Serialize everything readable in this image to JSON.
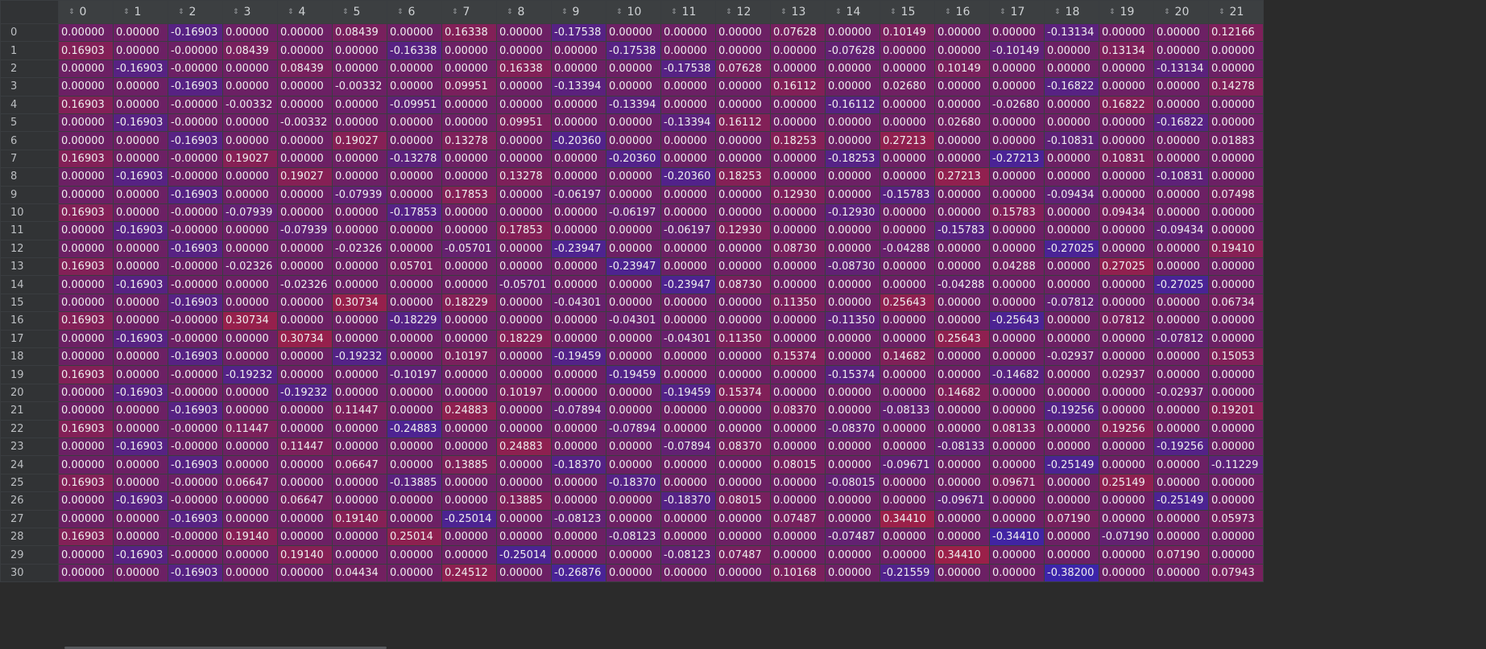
{
  "columns": [
    "0",
    "1",
    "2",
    "3",
    "4",
    "5",
    "6",
    "7",
    "8",
    "9",
    "10",
    "11",
    "12",
    "13",
    "14",
    "15",
    "16",
    "17",
    "18",
    "19",
    "20",
    "21"
  ],
  "sort_icon": "sort-updown-icon",
  "rows": [
    {
      "index": "0",
      "cells": [
        "0.00000",
        "0.00000",
        "-0.16903",
        "0.00000",
        "0.00000",
        "0.08439",
        "0.00000",
        "0.16338",
        "0.00000",
        "-0.17538",
        "0.00000",
        "0.00000",
        "0.00000",
        "0.07628",
        "0.00000",
        "0.10149",
        "0.00000",
        "0.00000",
        "-0.13134",
        "0.00000",
        "0.00000",
        "0.12166"
      ]
    },
    {
      "index": "1",
      "cells": [
        "0.16903",
        "0.00000",
        "-0.00000",
        "0.08439",
        "0.00000",
        "0.00000",
        "-0.16338",
        "0.00000",
        "0.00000",
        "0.00000",
        "-0.17538",
        "0.00000",
        "0.00000",
        "0.00000",
        "-0.07628",
        "0.00000",
        "0.00000",
        "-0.10149",
        "0.00000",
        "0.13134",
        "0.00000",
        "0.00000"
      ]
    },
    {
      "index": "2",
      "cells": [
        "0.00000",
        "-0.16903",
        "-0.00000",
        "0.00000",
        "0.08439",
        "0.00000",
        "0.00000",
        "0.00000",
        "0.16338",
        "0.00000",
        "0.00000",
        "-0.17538",
        "0.07628",
        "0.00000",
        "0.00000",
        "0.00000",
        "0.10149",
        "0.00000",
        "0.00000",
        "0.00000",
        "-0.13134",
        "0.00000"
      ]
    },
    {
      "index": "3",
      "cells": [
        "0.00000",
        "0.00000",
        "-0.16903",
        "0.00000",
        "0.00000",
        "-0.00332",
        "0.00000",
        "0.09951",
        "0.00000",
        "-0.13394",
        "0.00000",
        "0.00000",
        "0.00000",
        "0.16112",
        "0.00000",
        "0.02680",
        "0.00000",
        "0.00000",
        "-0.16822",
        "0.00000",
        "0.00000",
        "0.14278"
      ]
    },
    {
      "index": "4",
      "cells": [
        "0.16903",
        "0.00000",
        "-0.00000",
        "-0.00332",
        "0.00000",
        "0.00000",
        "-0.09951",
        "0.00000",
        "0.00000",
        "0.00000",
        "-0.13394",
        "0.00000",
        "0.00000",
        "0.00000",
        "-0.16112",
        "0.00000",
        "0.00000",
        "-0.02680",
        "0.00000",
        "0.16822",
        "0.00000",
        "0.00000"
      ]
    },
    {
      "index": "5",
      "cells": [
        "0.00000",
        "-0.16903",
        "-0.00000",
        "0.00000",
        "-0.00332",
        "0.00000",
        "0.00000",
        "0.00000",
        "0.09951",
        "0.00000",
        "0.00000",
        "-0.13394",
        "0.16112",
        "0.00000",
        "0.00000",
        "0.00000",
        "0.02680",
        "0.00000",
        "0.00000",
        "0.00000",
        "-0.16822",
        "0.00000"
      ]
    },
    {
      "index": "6",
      "cells": [
        "0.00000",
        "0.00000",
        "-0.16903",
        "0.00000",
        "0.00000",
        "0.19027",
        "0.00000",
        "0.13278",
        "0.00000",
        "-0.20360",
        "0.00000",
        "0.00000",
        "0.00000",
        "0.18253",
        "0.00000",
        "0.27213",
        "0.00000",
        "0.00000",
        "-0.10831",
        "0.00000",
        "0.00000",
        "0.01883"
      ]
    },
    {
      "index": "7",
      "cells": [
        "0.16903",
        "0.00000",
        "-0.00000",
        "0.19027",
        "0.00000",
        "0.00000",
        "-0.13278",
        "0.00000",
        "0.00000",
        "0.00000",
        "-0.20360",
        "0.00000",
        "0.00000",
        "0.00000",
        "-0.18253",
        "0.00000",
        "0.00000",
        "-0.27213",
        "0.00000",
        "0.10831",
        "0.00000",
        "0.00000"
      ]
    },
    {
      "index": "8",
      "cells": [
        "0.00000",
        "-0.16903",
        "-0.00000",
        "0.00000",
        "0.19027",
        "0.00000",
        "0.00000",
        "0.00000",
        "0.13278",
        "0.00000",
        "0.00000",
        "-0.20360",
        "0.18253",
        "0.00000",
        "0.00000",
        "0.00000",
        "0.27213",
        "0.00000",
        "0.00000",
        "0.00000",
        "-0.10831",
        "0.00000"
      ]
    },
    {
      "index": "9",
      "cells": [
        "0.00000",
        "0.00000",
        "-0.16903",
        "0.00000",
        "0.00000",
        "-0.07939",
        "0.00000",
        "0.17853",
        "0.00000",
        "-0.06197",
        "0.00000",
        "0.00000",
        "0.00000",
        "0.12930",
        "0.00000",
        "-0.15783",
        "0.00000",
        "0.00000",
        "-0.09434",
        "0.00000",
        "0.00000",
        "0.07498"
      ]
    },
    {
      "index": "10",
      "cells": [
        "0.16903",
        "0.00000",
        "-0.00000",
        "-0.07939",
        "0.00000",
        "0.00000",
        "-0.17853",
        "0.00000",
        "0.00000",
        "0.00000",
        "-0.06197",
        "0.00000",
        "0.00000",
        "0.00000",
        "-0.12930",
        "0.00000",
        "0.00000",
        "0.15783",
        "0.00000",
        "0.09434",
        "0.00000",
        "0.00000"
      ]
    },
    {
      "index": "11",
      "cells": [
        "0.00000",
        "-0.16903",
        "-0.00000",
        "0.00000",
        "-0.07939",
        "0.00000",
        "0.00000",
        "0.00000",
        "0.17853",
        "0.00000",
        "0.00000",
        "-0.06197",
        "0.12930",
        "0.00000",
        "0.00000",
        "0.00000",
        "-0.15783",
        "0.00000",
        "0.00000",
        "0.00000",
        "-0.09434",
        "0.00000"
      ]
    },
    {
      "index": "12",
      "cells": [
        "0.00000",
        "0.00000",
        "-0.16903",
        "0.00000",
        "0.00000",
        "-0.02326",
        "0.00000",
        "-0.05701",
        "0.00000",
        "-0.23947",
        "0.00000",
        "0.00000",
        "0.00000",
        "0.08730",
        "0.00000",
        "-0.04288",
        "0.00000",
        "0.00000",
        "-0.27025",
        "0.00000",
        "0.00000",
        "0.19410"
      ]
    },
    {
      "index": "13",
      "cells": [
        "0.16903",
        "0.00000",
        "-0.00000",
        "-0.02326",
        "0.00000",
        "0.00000",
        "0.05701",
        "0.00000",
        "0.00000",
        "0.00000",
        "-0.23947",
        "0.00000",
        "0.00000",
        "0.00000",
        "-0.08730",
        "0.00000",
        "0.00000",
        "0.04288",
        "0.00000",
        "0.27025",
        "0.00000",
        "0.00000"
      ]
    },
    {
      "index": "14",
      "cells": [
        "0.00000",
        "-0.16903",
        "-0.00000",
        "0.00000",
        "-0.02326",
        "0.00000",
        "0.00000",
        "0.00000",
        "-0.05701",
        "0.00000",
        "0.00000",
        "-0.23947",
        "0.08730",
        "0.00000",
        "0.00000",
        "0.00000",
        "-0.04288",
        "0.00000",
        "0.00000",
        "0.00000",
        "-0.27025",
        "0.00000"
      ]
    },
    {
      "index": "15",
      "cells": [
        "0.00000",
        "0.00000",
        "-0.16903",
        "0.00000",
        "0.00000",
        "0.30734",
        "0.00000",
        "0.18229",
        "0.00000",
        "-0.04301",
        "0.00000",
        "0.00000",
        "0.00000",
        "0.11350",
        "0.00000",
        "0.25643",
        "0.00000",
        "0.00000",
        "-0.07812",
        "0.00000",
        "0.00000",
        "0.06734"
      ]
    },
    {
      "index": "16",
      "cells": [
        "0.16903",
        "0.00000",
        "-0.00000",
        "0.30734",
        "0.00000",
        "0.00000",
        "-0.18229",
        "0.00000",
        "0.00000",
        "0.00000",
        "-0.04301",
        "0.00000",
        "0.00000",
        "0.00000",
        "-0.11350",
        "0.00000",
        "0.00000",
        "-0.25643",
        "0.00000",
        "0.07812",
        "0.00000",
        "0.00000"
      ]
    },
    {
      "index": "17",
      "cells": [
        "0.00000",
        "-0.16903",
        "-0.00000",
        "0.00000",
        "0.30734",
        "0.00000",
        "0.00000",
        "0.00000",
        "0.18229",
        "0.00000",
        "0.00000",
        "-0.04301",
        "0.11350",
        "0.00000",
        "0.00000",
        "0.00000",
        "0.25643",
        "0.00000",
        "0.00000",
        "0.00000",
        "-0.07812",
        "0.00000"
      ]
    },
    {
      "index": "18",
      "cells": [
        "0.00000",
        "0.00000",
        "-0.16903",
        "0.00000",
        "0.00000",
        "-0.19232",
        "0.00000",
        "0.10197",
        "0.00000",
        "-0.19459",
        "0.00000",
        "0.00000",
        "0.00000",
        "0.15374",
        "0.00000",
        "0.14682",
        "0.00000",
        "0.00000",
        "-0.02937",
        "0.00000",
        "0.00000",
        "0.15053"
      ]
    },
    {
      "index": "19",
      "cells": [
        "0.16903",
        "0.00000",
        "-0.00000",
        "-0.19232",
        "0.00000",
        "0.00000",
        "-0.10197",
        "0.00000",
        "0.00000",
        "0.00000",
        "-0.19459",
        "0.00000",
        "0.00000",
        "0.00000",
        "-0.15374",
        "0.00000",
        "0.00000",
        "-0.14682",
        "0.00000",
        "0.02937",
        "0.00000",
        "0.00000"
      ]
    },
    {
      "index": "20",
      "cells": [
        "0.00000",
        "-0.16903",
        "-0.00000",
        "0.00000",
        "-0.19232",
        "0.00000",
        "0.00000",
        "0.00000",
        "0.10197",
        "0.00000",
        "0.00000",
        "-0.19459",
        "0.15374",
        "0.00000",
        "0.00000",
        "0.00000",
        "0.14682",
        "0.00000",
        "0.00000",
        "0.00000",
        "-0.02937",
        "0.00000"
      ]
    },
    {
      "index": "21",
      "cells": [
        "0.00000",
        "0.00000",
        "-0.16903",
        "0.00000",
        "0.00000",
        "0.11447",
        "0.00000",
        "0.24883",
        "0.00000",
        "-0.07894",
        "0.00000",
        "0.00000",
        "0.00000",
        "0.08370",
        "0.00000",
        "-0.08133",
        "0.00000",
        "0.00000",
        "-0.19256",
        "0.00000",
        "0.00000",
        "0.19201"
      ]
    },
    {
      "index": "22",
      "cells": [
        "0.16903",
        "0.00000",
        "-0.00000",
        "0.11447",
        "0.00000",
        "0.00000",
        "-0.24883",
        "0.00000",
        "0.00000",
        "0.00000",
        "-0.07894",
        "0.00000",
        "0.00000",
        "0.00000",
        "-0.08370",
        "0.00000",
        "0.00000",
        "0.08133",
        "0.00000",
        "0.19256",
        "0.00000",
        "0.00000"
      ]
    },
    {
      "index": "23",
      "cells": [
        "0.00000",
        "-0.16903",
        "-0.00000",
        "0.00000",
        "0.11447",
        "0.00000",
        "0.00000",
        "0.00000",
        "0.24883",
        "0.00000",
        "0.00000",
        "-0.07894",
        "0.08370",
        "0.00000",
        "0.00000",
        "0.00000",
        "-0.08133",
        "0.00000",
        "0.00000",
        "0.00000",
        "-0.19256",
        "0.00000"
      ]
    },
    {
      "index": "24",
      "cells": [
        "0.00000",
        "0.00000",
        "-0.16903",
        "0.00000",
        "0.00000",
        "0.06647",
        "0.00000",
        "0.13885",
        "0.00000",
        "-0.18370",
        "0.00000",
        "0.00000",
        "0.00000",
        "0.08015",
        "0.00000",
        "-0.09671",
        "0.00000",
        "0.00000",
        "-0.25149",
        "0.00000",
        "0.00000",
        "-0.11229"
      ]
    },
    {
      "index": "25",
      "cells": [
        "0.16903",
        "0.00000",
        "-0.00000",
        "0.06647",
        "0.00000",
        "0.00000",
        "-0.13885",
        "0.00000",
        "0.00000",
        "0.00000",
        "-0.18370",
        "0.00000",
        "0.00000",
        "0.00000",
        "-0.08015",
        "0.00000",
        "0.00000",
        "0.09671",
        "0.00000",
        "0.25149",
        "0.00000",
        "0.00000"
      ]
    },
    {
      "index": "26",
      "cells": [
        "0.00000",
        "-0.16903",
        "-0.00000",
        "0.00000",
        "0.06647",
        "0.00000",
        "0.00000",
        "0.00000",
        "0.13885",
        "0.00000",
        "0.00000",
        "-0.18370",
        "0.08015",
        "0.00000",
        "0.00000",
        "0.00000",
        "-0.09671",
        "0.00000",
        "0.00000",
        "0.00000",
        "-0.25149",
        "0.00000"
      ]
    },
    {
      "index": "27",
      "cells": [
        "0.00000",
        "0.00000",
        "-0.16903",
        "0.00000",
        "0.00000",
        "0.19140",
        "0.00000",
        "-0.25014",
        "0.00000",
        "-0.08123",
        "0.00000",
        "0.00000",
        "0.00000",
        "0.07487",
        "0.00000",
        "0.34410",
        "0.00000",
        "0.00000",
        "0.07190",
        "0.00000",
        "0.00000",
        "0.05973"
      ]
    },
    {
      "index": "28",
      "cells": [
        "0.16903",
        "0.00000",
        "-0.00000",
        "0.19140",
        "0.00000",
        "0.00000",
        "0.25014",
        "0.00000",
        "0.00000",
        "0.00000",
        "-0.08123",
        "0.00000",
        "0.00000",
        "0.00000",
        "-0.07487",
        "0.00000",
        "0.00000",
        "-0.34410",
        "0.00000",
        "-0.07190",
        "0.00000",
        "0.00000"
      ]
    },
    {
      "index": "29",
      "cells": [
        "0.00000",
        "-0.16903",
        "-0.00000",
        "0.00000",
        "0.19140",
        "0.00000",
        "0.00000",
        "0.00000",
        "-0.25014",
        "0.00000",
        "0.00000",
        "-0.08123",
        "0.07487",
        "0.00000",
        "0.00000",
        "0.00000",
        "0.34410",
        "0.00000",
        "0.00000",
        "0.00000",
        "0.07190",
        "0.00000"
      ]
    },
    {
      "index": "30",
      "cells": [
        "0.00000",
        "0.00000",
        "-0.16903",
        "0.00000",
        "0.00000",
        "0.04434",
        "0.00000",
        "0.24512",
        "0.00000",
        "-0.26876",
        "0.00000",
        "0.00000",
        "0.00000",
        "0.10168",
        "0.00000",
        "-0.21559",
        "0.00000",
        "0.00000",
        "-0.38200",
        "0.00000",
        "0.00000",
        "0.07943"
      ]
    }
  ]
}
